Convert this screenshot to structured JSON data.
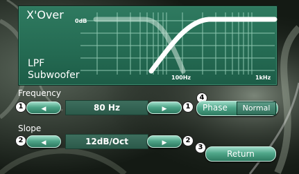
{
  "panel": {
    "title": "X'Over",
    "label_line1": "LPF",
    "label_line2": "Subwoofer",
    "y_axis_label": "0dB",
    "x_tick_100": "100Hz",
    "x_tick_1k": "1kHz"
  },
  "frequency": {
    "caption": "Frequency",
    "value": "80 Hz",
    "down_badge": "1",
    "up_badge": "1"
  },
  "slope": {
    "caption": "Slope",
    "value": "12dB/Oct",
    "down_badge": "2",
    "up_badge": "2"
  },
  "phase": {
    "badge": "4",
    "label": "Phase",
    "value": "Normal"
  },
  "return": {
    "badge": "3",
    "label": "Return"
  },
  "icons": {
    "left": "◀",
    "right": "▶"
  }
}
